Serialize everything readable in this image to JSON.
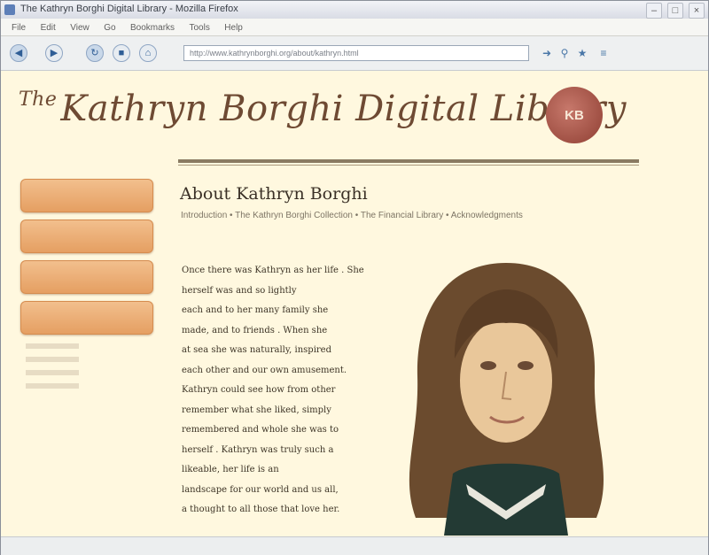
{
  "window": {
    "title": "The Kathryn Borghi Digital Library - Mozilla Firefox"
  },
  "menu": [
    "File",
    "Edit",
    "View",
    "Go",
    "Bookmarks",
    "Tools",
    "Help"
  ],
  "url_bar": {
    "value": "http://www.kathrynborghi.org/about/kathryn.html"
  },
  "site": {
    "logo_the": "The",
    "logo_text": "Kathryn Borghi Digital Library",
    "seal_text": "KB"
  },
  "content": {
    "heading": "About Kathryn Borghi",
    "breadcrumb": "Introduction • The Kathryn Borghi Collection • The Financial Library • Acknowledgments",
    "paragraph_lines": [
      "Once there was Kathryn as her life . She",
      "herself was and so lightly",
      "each and to her many family she",
      "made, and to friends . When she",
      "at sea she was naturally, inspired",
      "each other and our own amusement.",
      "Kathryn could see how from other",
      "remember what she liked, simply",
      "remembered and whole she was to",
      "herself . Kathryn was truly such a",
      "likeable, her life is an",
      "landscape for our world and us all,",
      "a thought to all those that love her."
    ]
  },
  "colors": {
    "page_bg": "#fff8df",
    "button_orange": "#e59f62",
    "text_brown": "#3d3426",
    "seal_red": "#8f3f33"
  }
}
